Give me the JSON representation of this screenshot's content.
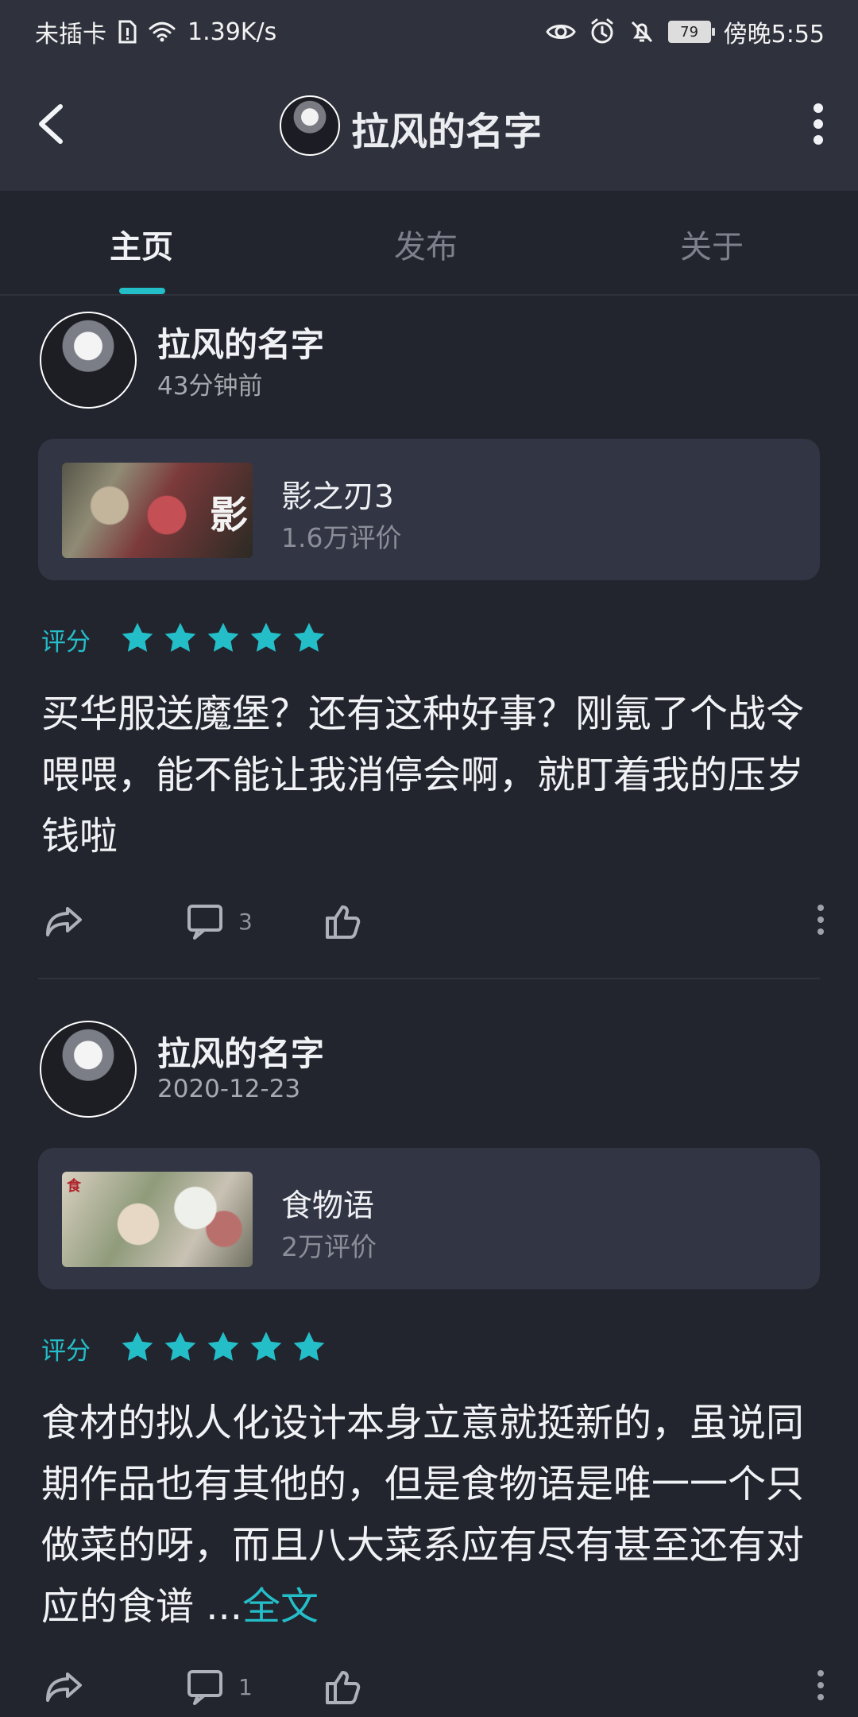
{
  "status_bar": {
    "carrier": "未插卡",
    "network_speed": "1.39K/s",
    "battery": "79",
    "time": "傍晚5:55"
  },
  "header": {
    "title": "拉风的名字"
  },
  "tabs": [
    {
      "label": "主页",
      "active": true
    },
    {
      "label": "发布",
      "active": false
    },
    {
      "label": "关于",
      "active": false
    }
  ],
  "posts": [
    {
      "username": "拉风的名字",
      "time": "43分钟前",
      "game": {
        "name": "影之刃3",
        "rating_count": "1.6万评价"
      },
      "rating_label": "评分",
      "rating": 5,
      "text": "买华服送魔堡？还有这种好事？刚氪了个战令喂喂，能不能让我消停会啊，就盯着我的压岁钱啦",
      "comments": "3"
    },
    {
      "username": "拉风的名字",
      "time": "2020-12-23",
      "game": {
        "name": "食物语",
        "rating_count": "2万评价"
      },
      "rating_label": "评分",
      "rating": 5,
      "text": "食材的拟人化设计本身立意就挺新的，虽说同期作品也有其他的，但是食物语是唯一一个只做菜的呀，而且八大菜系应有尽有甚至还有对应的食谱 ...",
      "read_more": "全文",
      "comments": "1"
    }
  ],
  "colors": {
    "accent": "#24bec9",
    "background": "#23252e",
    "header": "#2f323d",
    "card": "#323543"
  },
  "icons": [
    "back-icon",
    "more-vertical-icon",
    "share-icon",
    "comment-icon",
    "like-icon",
    "star-icon"
  ]
}
